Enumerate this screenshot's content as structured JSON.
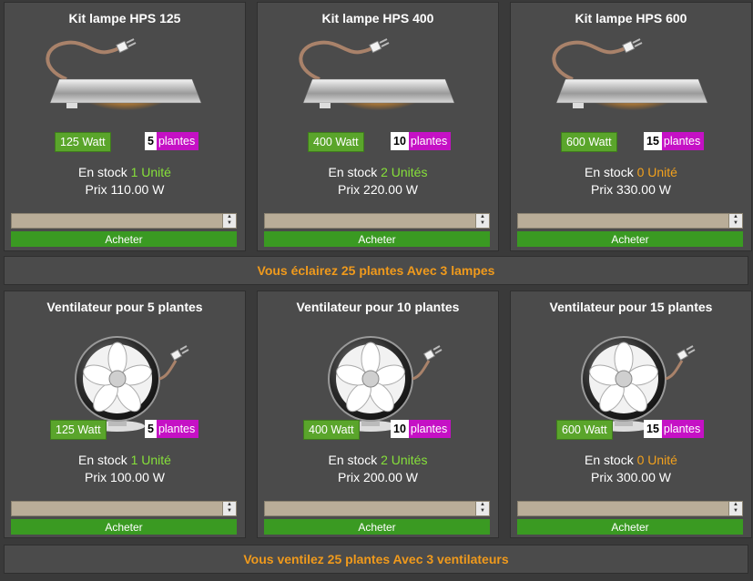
{
  "lamps": [
    {
      "title": "Kit lampe HPS 125",
      "watt": "125 Watt",
      "plants_num": "5",
      "plants_label": "plantes",
      "stock_prefix": "En stock",
      "stock_units": "1 Unité",
      "price": "Prix 110.00 W",
      "buy_label": "Acheter"
    },
    {
      "title": "Kit lampe HPS 400",
      "watt": "400 Watt",
      "plants_num": "10",
      "plants_label": "plantes",
      "stock_prefix": "En stock",
      "stock_units": "2 Unités",
      "price": "Prix 220.00 W",
      "buy_label": "Acheter"
    },
    {
      "title": "Kit lampe HPS 600",
      "watt": "600 Watt",
      "plants_num": "15",
      "plants_label": "plantes",
      "stock_prefix": "En stock",
      "stock_units": "0 Unité",
      "price": "Prix 330.00 W",
      "buy_label": "Acheter"
    }
  ],
  "lamp_summary": "Vous éclairez 25 plantes Avec 3 lampes",
  "fans": [
    {
      "title": "Ventilateur pour 5 plantes",
      "watt": "125 Watt",
      "plants_num": "5",
      "plants_label": "plantes",
      "stock_prefix": "En stock",
      "stock_units": "1 Unité",
      "price": "Prix 100.00 W",
      "buy_label": "Acheter"
    },
    {
      "title": "Ventilateur pour 10 plantes",
      "watt": "400 Watt",
      "plants_num": "10",
      "plants_label": "plantes",
      "stock_prefix": "En stock",
      "stock_units": "2 Unités",
      "price": "Prix 200.00 W",
      "buy_label": "Acheter"
    },
    {
      "title": "Ventilateur pour 15 plantes",
      "watt": "600 Watt",
      "plants_num": "15",
      "plants_label": "plantes",
      "stock_prefix": "En stock",
      "stock_units": "0 Unité",
      "price": "Prix 300.00 W",
      "buy_label": "Acheter"
    }
  ],
  "fan_summary": "Vous ventilez 25 plantes Avec 3 ventilateurs",
  "icons": {
    "lamp": "hps-lamp-icon",
    "fan": "fan-icon",
    "spinner": "spinner-arrows-icon"
  },
  "colors": {
    "watt_badge": "#5aa52b",
    "plants_badge": "#c511c5",
    "buy_button": "#3a9a22",
    "summary_text": "#f09a1c",
    "stock_in": "#86e03a",
    "stock_out": "#f2a11d"
  }
}
